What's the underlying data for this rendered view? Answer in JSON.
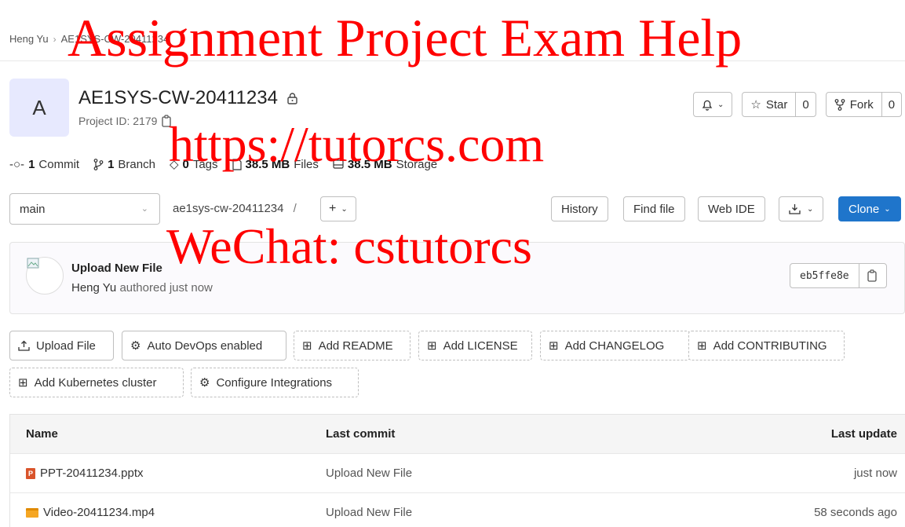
{
  "breadcrumb": {
    "user": "Heng Yu",
    "project": "AE1SYS-CW-20411234"
  },
  "project": {
    "avatar_letter": "A",
    "title": "AE1SYS-CW-20411234",
    "id_label": "Project ID: 2179"
  },
  "header_actions": {
    "star_label": "Star",
    "star_count": "0",
    "fork_label": "Fork",
    "fork_count": "0"
  },
  "stats": {
    "commits_count": "1",
    "commits_label": "Commit",
    "branches_count": "1",
    "branches_label": "Branch",
    "tags_count": "0",
    "tags_label": "Tags",
    "files_size": "38.5 MB",
    "files_label": "Files",
    "storage_size": "38.5 MB",
    "storage_label": "Storage"
  },
  "toolbar": {
    "branch": "main",
    "path": "ae1sys-cw-20411234",
    "path_sep": "/",
    "history": "History",
    "find_file": "Find file",
    "web_ide": "Web IDE",
    "clone": "Clone"
  },
  "last_commit": {
    "title": "Upload New File",
    "author": "Heng Yu",
    "meta": "authored just now",
    "sha": "eb5ffe8e"
  },
  "actions": [
    "Upload File",
    "Auto DevOps enabled",
    "Add README",
    "Add LICENSE",
    "Add CHANGELOG",
    "Add CONTRIBUTING",
    "Add Kubernetes cluster",
    "Configure Integrations"
  ],
  "table": {
    "headers": {
      "name": "Name",
      "last_commit": "Last commit",
      "last_update": "Last update"
    },
    "rows": [
      {
        "name": "PPT-20411234.pptx",
        "icon": "pptx-file-icon",
        "commit": "Upload New File",
        "updated": "just now"
      },
      {
        "name": "Video-20411234.mp4",
        "icon": "video-file-icon",
        "commit": "Upload New File",
        "updated": "58 seconds ago"
      }
    ]
  },
  "watermarks": {
    "line1": "Assignment Project Exam Help",
    "line2": "https://tutorcs.com",
    "line3": "WeChat: cstutorcs"
  },
  "colors": {
    "primary": "#1f75cb",
    "watermark": "#ff0000",
    "avatar_bg": "#e7e9fe"
  }
}
